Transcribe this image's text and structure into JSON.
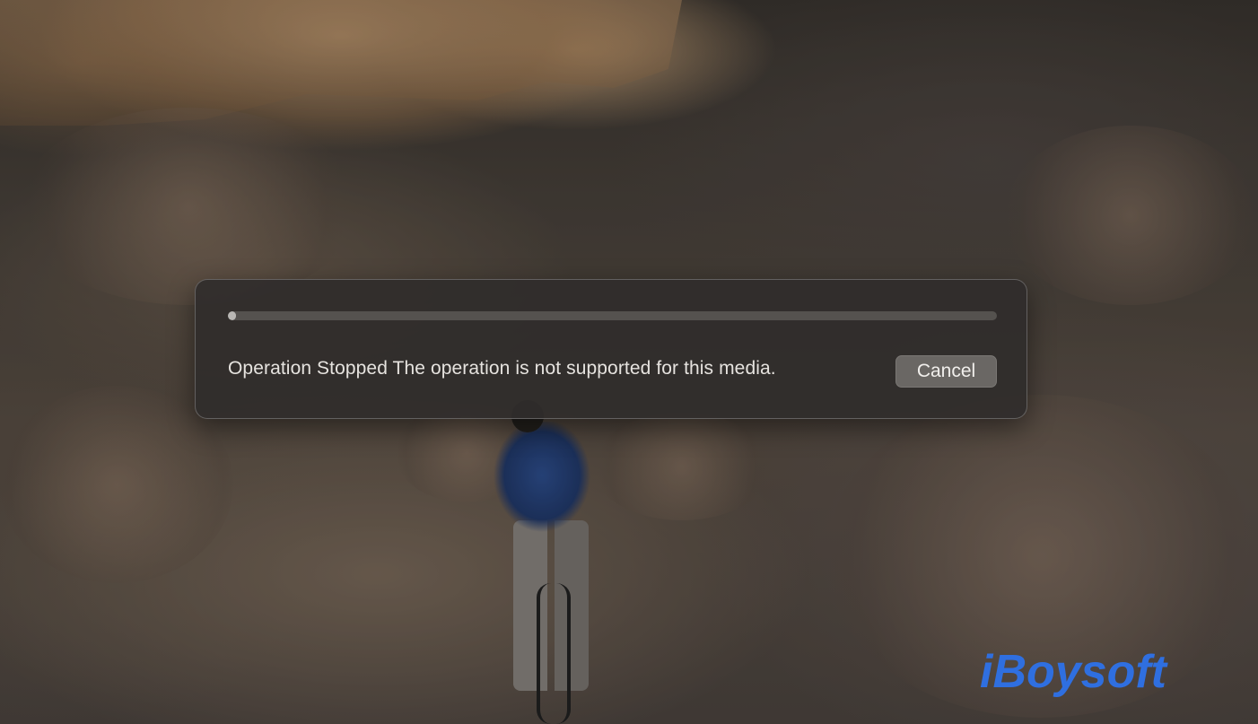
{
  "dialog": {
    "progress_fraction": 0.01,
    "message": "Operation Stopped The operation is not supported for this media.",
    "cancel_label": "Cancel"
  },
  "watermark": {
    "text": "iBoysoft",
    "color": "#2f6fe0"
  },
  "colors": {
    "dialog_background": "#302d2b",
    "button_background": "#6a6764",
    "text": "#e6e3df"
  }
}
